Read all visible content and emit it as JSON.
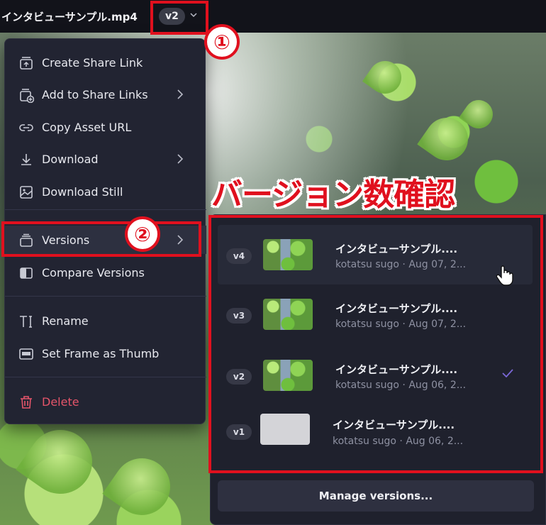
{
  "titlebar": {
    "file_name": "インタビューサンプル.mp4",
    "current_version": "v2"
  },
  "menu": {
    "items": [
      {
        "label": "Create Share Link",
        "icon": "share-link-icon",
        "submenu": false
      },
      {
        "label": "Add to Share Links",
        "icon": "add-share-links-icon",
        "submenu": true
      },
      {
        "label": "Copy Asset URL",
        "icon": "link-icon",
        "submenu": false
      },
      {
        "label": "Download",
        "icon": "download-icon",
        "submenu": true
      },
      {
        "label": "Download Still",
        "icon": "image-icon",
        "submenu": false
      },
      {
        "label": "Versions",
        "icon": "versions-stack-icon",
        "submenu": true
      },
      {
        "label": "Compare Versions",
        "icon": "compare-icon",
        "submenu": false
      },
      {
        "label": "Rename",
        "icon": "text-cursor-icon",
        "submenu": false
      },
      {
        "label": "Set Frame as Thumb",
        "icon": "thumbnail-icon",
        "submenu": false
      },
      {
        "label": "Delete",
        "icon": "trash-icon",
        "submenu": false,
        "danger": true
      }
    ]
  },
  "versions": {
    "rows": [
      {
        "version": "v4",
        "title": "インタビューサンプル....",
        "meta": "kotatsu sugo · Aug 07, 2...",
        "selected": false,
        "hovered": true
      },
      {
        "version": "v3",
        "title": "インタビューサンプル....",
        "meta": "kotatsu sugo · Aug 07, 2...",
        "selected": false,
        "hovered": false
      },
      {
        "version": "v2",
        "title": "インタビューサンプル....",
        "meta": "kotatsu sugo · Aug 06, 2...",
        "selected": true,
        "hovered": false
      },
      {
        "version": "v1",
        "title": "インタビューサンプル....",
        "meta": "kotatsu sugo · Aug 06, 2...",
        "selected": false,
        "hovered": false
      }
    ],
    "manage_label": "Manage versions..."
  },
  "annotations": {
    "badge_1": "①",
    "badge_2": "②",
    "heading": "バージョン数確認"
  },
  "colors": {
    "annotation_red": "#e0101e",
    "menu_bg": "#222432",
    "danger": "#e5556a",
    "check_accent": "#7b68d8"
  }
}
